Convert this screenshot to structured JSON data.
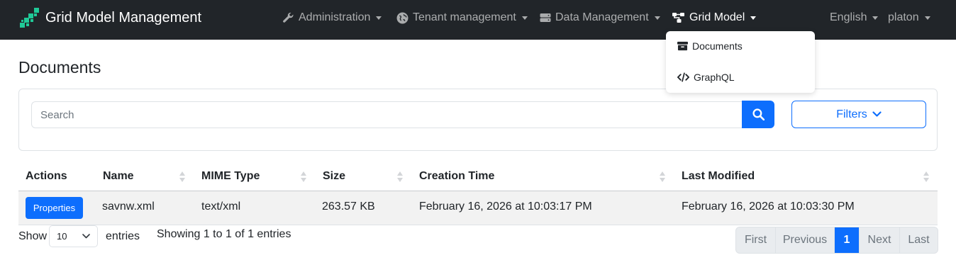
{
  "navbar": {
    "brand": "Grid Model Management",
    "items": [
      {
        "label": "Administration",
        "icon": "wrench-icon"
      },
      {
        "label": "Tenant management",
        "icon": "globe-icon"
      },
      {
        "label": "Data Management",
        "icon": "database-icon"
      },
      {
        "label": "Grid Model",
        "icon": "sitemap-icon"
      }
    ],
    "language": "English",
    "user": "platon"
  },
  "dropdown": {
    "items": [
      {
        "label": "Documents",
        "icon": "archive-icon"
      },
      {
        "label": "GraphQL",
        "icon": "code-icon"
      }
    ]
  },
  "page": {
    "title": "Documents"
  },
  "search": {
    "placeholder": "Search",
    "filters_label": "Filters"
  },
  "table": {
    "columns": [
      "Actions",
      "Name",
      "MIME Type",
      "Size",
      "Creation Time",
      "Last Modified"
    ],
    "rows": [
      {
        "action": "Properties",
        "name": "savnw.xml",
        "mime": "text/xml",
        "size": "263.57 KB",
        "created": "February 16, 2026 at 10:03:17 PM",
        "modified": "February 16, 2026 at 10:03:30 PM"
      }
    ]
  },
  "footer": {
    "show_label": "Show",
    "page_length": "10",
    "entries_label": "entries",
    "info": "Showing 1 to 1 of 1 entries"
  },
  "pagination": {
    "first": "First",
    "previous": "Previous",
    "current": "1",
    "next": "Next",
    "last": "Last"
  },
  "colors": {
    "navbar": "#212529",
    "primary": "#0d6efd",
    "logo": "#20c997"
  }
}
